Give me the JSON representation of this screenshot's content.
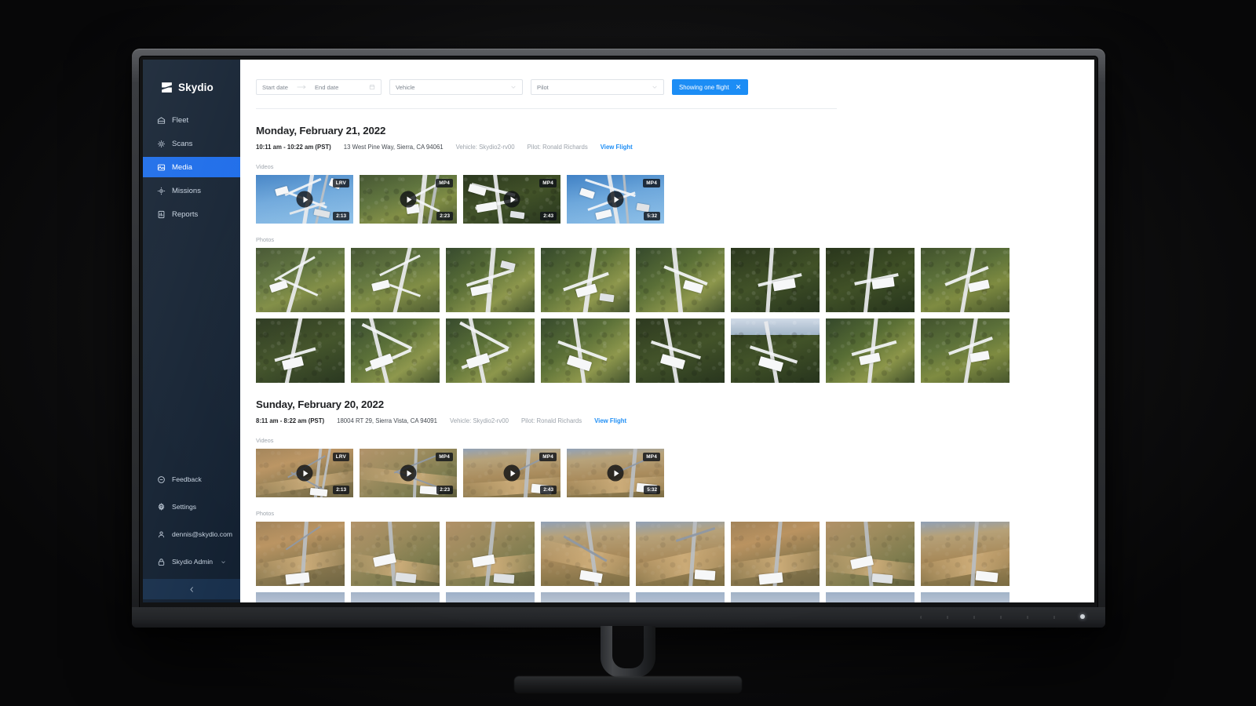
{
  "app": {
    "brand": "Skydio"
  },
  "sidebar": {
    "nav": [
      {
        "label": "Fleet",
        "icon": "fleet-icon",
        "active": false
      },
      {
        "label": "Scans",
        "icon": "scans-icon",
        "active": false
      },
      {
        "label": "Media",
        "icon": "media-icon",
        "active": true
      },
      {
        "label": "Missions",
        "icon": "missions-icon",
        "active": false
      },
      {
        "label": "Reports",
        "icon": "reports-icon",
        "active": false
      }
    ],
    "bottom": [
      {
        "label": "Feedback",
        "icon": "feedback-icon",
        "chevron": false
      },
      {
        "label": "Settings",
        "icon": "gear-icon",
        "chevron": false
      },
      {
        "label": "dennis@skydio.com",
        "icon": "user-icon",
        "chevron": true
      },
      {
        "label": "Skydio Admin",
        "icon": "lock-icon",
        "chevron": true
      }
    ],
    "collapse_icon": "chevron-left-icon",
    "active_color": "#1366e8",
    "background_color": "#0c1a2b"
  },
  "filters": {
    "start_date_placeholder": "Start date",
    "end_date_placeholder": "End date",
    "calendar_icon": "calendar-icon",
    "range_arrow_icon": "arrow-right-icon",
    "vehicle_placeholder": "Vehicle",
    "pilot_placeholder": "Pilot",
    "chip_label": "Showing one flight",
    "chip_close_icon": "close-icon",
    "chip_color": "#1a8cf5"
  },
  "labels": {
    "videos": "Videos",
    "photos": "Photos",
    "vehicle_prefix": "Vehicle:",
    "pilot_prefix": "Pilot:",
    "view_flight": "View Flight"
  },
  "groups": [
    {
      "date": "Monday, February 21, 2022",
      "time": "10:11 am - 10:22 am (PST)",
      "address": "13 West Pine Way, Sierra, CA 94061",
      "vehicle": "Vehicle: Skydio2-rv00",
      "pilot": "Pilot: Ronald Richards",
      "view_flight": "View Flight",
      "videos": [
        {
          "format": "LRV",
          "duration": "2:13",
          "scene": "blue"
        },
        {
          "format": "MP4",
          "duration": "2:23",
          "scene": "forest"
        },
        {
          "format": "MP4",
          "duration": "2:43",
          "scene": "dark"
        },
        {
          "format": "MP4",
          "duration": "5:32",
          "scene": "blue"
        }
      ],
      "photo_rows": [
        [
          "forest",
          "forest",
          "forest2",
          "forest2",
          "forest2",
          "dark",
          "dark",
          "forest"
        ],
        [
          "dark",
          "forest2",
          "forest2",
          "forest2",
          "dark",
          "dark",
          "forest2",
          "forest"
        ]
      ]
    },
    {
      "date": "Sunday, February 20, 2022",
      "time": "8:11 am - 8:22 am (PST)",
      "address": "18004 RT 29, Sierra Vista, CA 94091",
      "vehicle": "Vehicle: Skydio2-rv00",
      "pilot": "Pilot: Ronald Richards",
      "view_flight": "View Flight",
      "videos": [
        {
          "format": "LRV",
          "duration": "2:13",
          "scene": "dirt"
        },
        {
          "format": "MP4",
          "duration": "2:23",
          "scene": "dirt2"
        },
        {
          "format": "MP4",
          "duration": "2:43",
          "scene": "dirt3"
        },
        {
          "format": "MP4",
          "duration": "5:32",
          "scene": "dirt3"
        }
      ],
      "photo_rows": [
        [
          "dirt",
          "dirt2",
          "dirt2",
          "dirt3",
          "dirt3",
          "dirt",
          "dirt2",
          "dirt3"
        ]
      ]
    }
  ]
}
